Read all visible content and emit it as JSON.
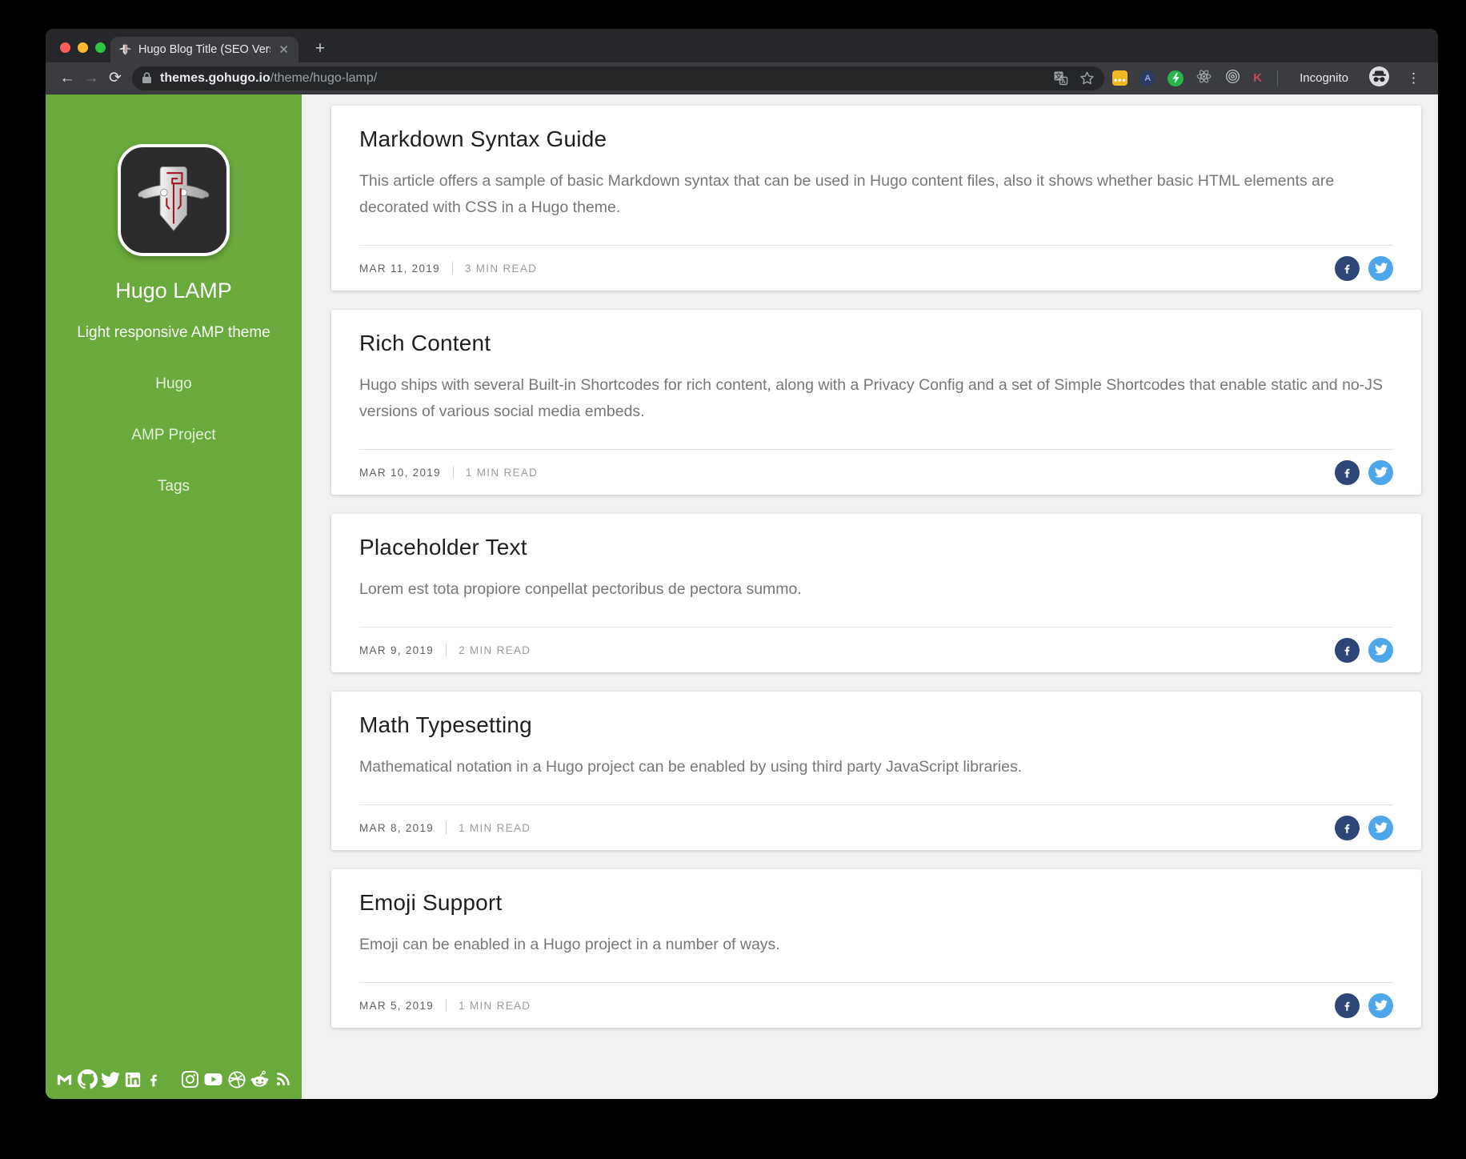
{
  "browser": {
    "tab_title": "Hugo Blog Title (SEO Version)",
    "new_tab_label": "+",
    "close_tab_label": "✕",
    "back_label": "←",
    "forward_label": "→",
    "reload_label": "⟳",
    "url_host": "themes.gohugo.io",
    "url_path": "/theme/hugo-lamp/",
    "incognito_label": "Incognito",
    "menu_label": "⋮",
    "extension_dots": "•••",
    "extension_a": "A",
    "extension_k": "K",
    "icons": [
      "lamp-favicon",
      "lock-icon",
      "translate-icon",
      "star-icon",
      "extension-dots-icon",
      "extension-a-icon",
      "extension-bolt-icon",
      "extension-atom-icon",
      "extension-target-icon",
      "extension-k-icon",
      "incognito-badge-icon"
    ]
  },
  "sidebar": {
    "title": "Hugo LAMP",
    "subtitle": "Light responsive AMP theme",
    "nav": [
      {
        "label": "Hugo"
      },
      {
        "label": "AMP Project"
      },
      {
        "label": "Tags"
      }
    ],
    "social_icons": [
      "email",
      "github",
      "twitter",
      "linkedin",
      "facebook",
      "instagram",
      "youtube",
      "dribbble",
      "reddit",
      "rss"
    ],
    "accent_green": "#69aa3c"
  },
  "posts": [
    {
      "title": "Markdown Syntax Guide",
      "excerpt": "This article offers a sample of basic Markdown syntax that can be used in Hugo content files, also it shows whether basic HTML elements are decorated with CSS in a Hugo theme.",
      "date": "MAR 11, 2019",
      "read_time": "3 MIN READ"
    },
    {
      "title": "Rich Content",
      "excerpt": "Hugo ships with several Built-in Shortcodes for rich content, along with a Privacy Config and a set of Simple Shortcodes that enable static and no-JS versions of various social media embeds.",
      "date": "MAR 10, 2019",
      "read_time": "1 MIN READ"
    },
    {
      "title": "Placeholder Text",
      "excerpt": "Lorem est tota propiore conpellat pectoribus de pectora summo.",
      "date": "MAR 9, 2019",
      "read_time": "2 MIN READ"
    },
    {
      "title": "Math Typesetting",
      "excerpt": "Mathematical notation in a Hugo project can be enabled by using third party JavaScript libraries.",
      "date": "MAR 8, 2019",
      "read_time": "1 MIN READ"
    },
    {
      "title": "Emoji Support",
      "excerpt": "Emoji can be enabled in a Hugo project in a number of ways.",
      "date": "MAR 5, 2019",
      "read_time": "1 MIN READ"
    }
  ],
  "share": {
    "facebook_color": "#2e4577",
    "twitter_color": "#4da7e9"
  }
}
